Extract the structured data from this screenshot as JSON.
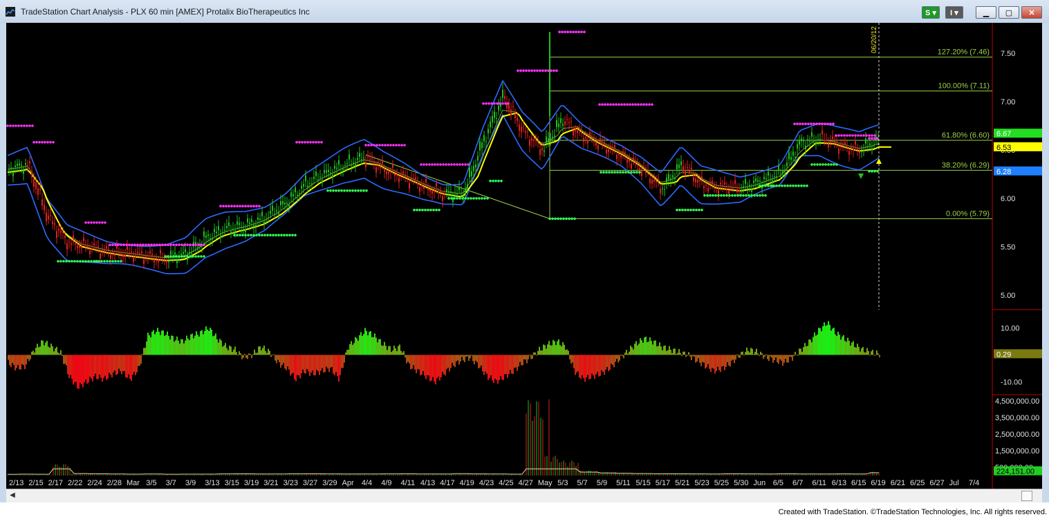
{
  "window": {
    "title": "TradeStation Chart Analysis - PLX 60 min [AMEX] Protalix BioTherapeutics Inc",
    "buttons": {
      "s": "S",
      "i": "I",
      "minimize": "minimize",
      "maximize": "maximize",
      "close": "close"
    }
  },
  "footer": {
    "text": "Created with TradeStation. ©TradeStation Technologies, Inc. All rights reserved."
  },
  "colors": {
    "background": "#000000",
    "up_candle": "#20c020",
    "down_candle": "#e02020",
    "band": "#2a6bff",
    "average": "#ffff00",
    "marker_high": "#ff33ff",
    "marker_low": "#33ff55",
    "fib_line": "#9bd24a",
    "axis_text": "#e0e0e0"
  },
  "chart_data": [
    {
      "type": "line",
      "panel": "price",
      "title": "PLX 60 min [AMEX]",
      "ylim": [
        4.85,
        7.8
      ],
      "yticks": [
        "7.50",
        "7.00",
        "6.50",
        "6.00",
        "5.50",
        "5.00"
      ],
      "x": [
        "2/13",
        "2/15",
        "2/17",
        "2/22",
        "2/24",
        "2/28",
        "Mar",
        "3/5",
        "3/7",
        "3/9",
        "3/13",
        "3/15",
        "3/19",
        "3/21",
        "3/23",
        "3/27",
        "3/29",
        "Apr",
        "4/4",
        "4/9",
        "4/11",
        "4/13",
        "4/17",
        "4/19",
        "4/23",
        "4/25",
        "4/27",
        "May",
        "5/3",
        "5/7",
        "5/9",
        "5/11",
        "5/15",
        "5/17",
        "5/21",
        "5/23",
        "5/25",
        "5/30",
        "Jun",
        "6/5",
        "6/7",
        "6/11",
        "6/13",
        "6/15",
        "6/19",
        "6/21",
        "6/25",
        "6/27",
        "Jul",
        "7/4"
      ],
      "series": [
        {
          "values": [
            6.3,
            6.35,
            5.8,
            5.55,
            5.5,
            5.45,
            5.43,
            5.4,
            5.38,
            5.42,
            5.6,
            5.68,
            5.72,
            5.8,
            5.95,
            6.15,
            6.25,
            6.35,
            6.42,
            6.3,
            6.22,
            6.12,
            6.05,
            6.05,
            6.6,
            7.05,
            6.7,
            6.5,
            6.82,
            6.65,
            6.55,
            6.45,
            6.3,
            6.1,
            6.35,
            6.15,
            6.12,
            6.1,
            6.18,
            6.25,
            6.58,
            6.62,
            6.55,
            6.5,
            6.6
          ]
        }
      ],
      "fib_levels": [
        {
          "label": "127.20% (7.46)",
          "value": 7.46
        },
        {
          "label": "100.00% (7.11)",
          "value": 7.11
        },
        {
          "label": "61.80% (6.60)",
          "value": 6.6
        },
        {
          "label": "38.20% (6.29)",
          "value": 6.29
        },
        {
          "label": "0.00% (5.79)",
          "value": 5.79
        }
      ],
      "price_tags": [
        {
          "label": "6.67",
          "value": 6.67,
          "color": "#22dd22"
        },
        {
          "label": "6.53",
          "value": 6.53,
          "color": "#ffff00"
        },
        {
          "label": "6.28",
          "value": 6.28,
          "color": "#1e7fff"
        }
      ],
      "date_marker": "06/20/12"
    },
    {
      "type": "area",
      "panel": "oscillator",
      "ylim": [
        -14,
        15
      ],
      "yticks": [
        "10.00",
        "-10.00"
      ],
      "last_value": "0.29",
      "values": [
        -3,
        -5,
        -4,
        2,
        5,
        3,
        1,
        -8,
        -12,
        -10,
        -8,
        -9,
        -7,
        -6,
        -9,
        -5,
        7,
        9,
        8,
        6,
        5,
        7,
        8,
        10,
        6,
        3,
        2,
        -1,
        0,
        3,
        1,
        -3,
        -5,
        -9,
        -6,
        -7,
        -6,
        -5,
        -9,
        3,
        6,
        9,
        7,
        4,
        2,
        3,
        -4,
        -6,
        -8,
        -10,
        -7,
        -4,
        -2,
        -1,
        -4,
        -8,
        -10,
        -8,
        -6,
        -3,
        -1,
        2,
        4,
        5,
        3,
        -6,
        -9,
        -8,
        -7,
        -5,
        -2,
        1,
        4,
        6,
        5,
        3,
        2,
        1,
        0,
        -2,
        -4,
        -6,
        -5,
        -3,
        0,
        2,
        1,
        -1,
        -2,
        -3,
        -1,
        2,
        5,
        9,
        12,
        8,
        6,
        4,
        2,
        1,
        0.29
      ]
    },
    {
      "type": "bar",
      "panel": "volume",
      "ylim": [
        0,
        4800000
      ],
      "yticks": [
        "4,500,000.00",
        "3,500,000.00",
        "2,500,000.00",
        "1,500,000.00",
        "500,000.00"
      ],
      "last_value": "224,151.00",
      "values": [
        30000,
        50000,
        40000,
        700000,
        120000,
        90000,
        60000,
        50000,
        60000,
        40000,
        45000,
        50000,
        80000,
        90000,
        70000,
        60000,
        100000,
        90000,
        80000,
        70000,
        60000,
        80000,
        90000,
        60000,
        70000,
        110000,
        80000,
        60000,
        50000,
        4600000,
        1200000,
        900000,
        300000,
        200000,
        150000,
        120000,
        100000,
        90000,
        80000,
        70000,
        90000,
        80000,
        70000,
        90000,
        60000,
        70000,
        80000,
        60000,
        224151
      ]
    }
  ]
}
